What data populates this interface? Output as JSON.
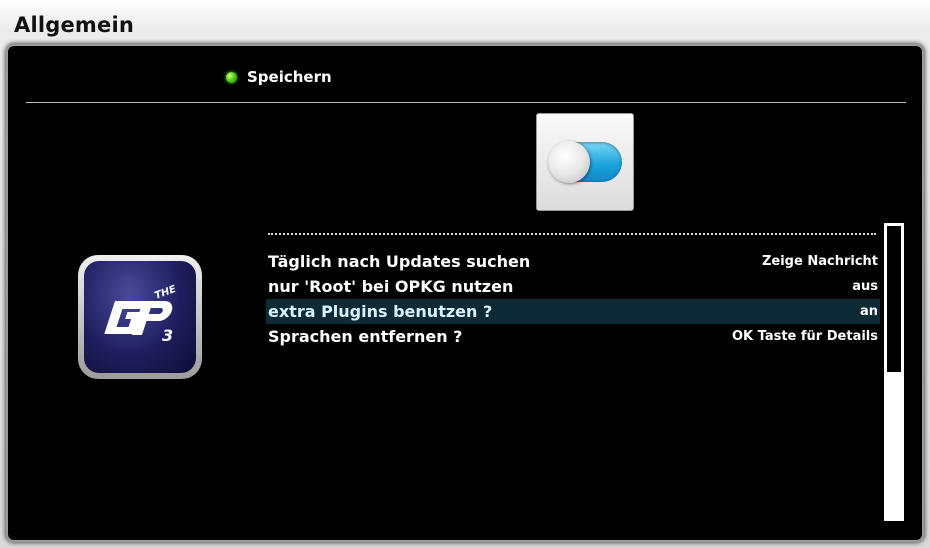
{
  "window": {
    "title": "Allgemein"
  },
  "header": {
    "save_label": "Speichern",
    "save_led_color": "#5fd41e"
  },
  "toggle_icon": {
    "name": "toggle-switch-icon",
    "state": "on",
    "accent": "#1da5dd"
  },
  "logo": {
    "name": "the-gp3-logo"
  },
  "settings": {
    "items": [
      {
        "label": "Täglich nach Updates suchen",
        "value": "Zeige Nachricht",
        "selected": false
      },
      {
        "label": "nur 'Root' bei OPKG nutzen",
        "value": "aus",
        "selected": false
      },
      {
        "label": "extra Plugins benutzen ?",
        "value": "an",
        "selected": true
      },
      {
        "label": "Sprachen entfernen ?",
        "value": "OK Taste für Details",
        "selected": false
      }
    ]
  },
  "scrollbar": {
    "position_fraction": 0.5
  }
}
